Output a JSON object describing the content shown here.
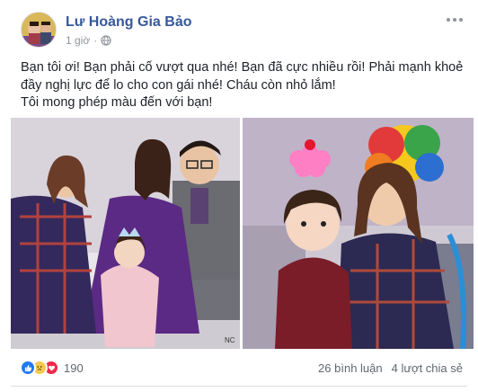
{
  "post": {
    "author": "Lư Hoàng Gia Bảo",
    "time": "1 giờ",
    "privacy_icon": "globe-icon",
    "text_lines": [
      "Bạn tôi ơi! Bạn phải cố vượt qua nhé! Bạn đã cực nhiều rồi! Phải mạnh khoẻ",
      "đầy nghị lực để lo cho con gái nhé! Cháu còn nhỏ lắm!",
      "Tôi mong phép màu đến với bạn!"
    ],
    "photo_watermark": "NC"
  },
  "footer": {
    "reaction_icons": [
      "like-icon",
      "sad-icon",
      "love-icon"
    ],
    "reaction_count": "190",
    "comments": "26 bình luận",
    "shares": "4 lượt chia sẻ"
  },
  "colors": {
    "author": "#365899",
    "meta": "#90949c",
    "text": "#1d2129",
    "like": "#2078f4",
    "sad": "#f7c94f",
    "love": "#f0284a"
  }
}
